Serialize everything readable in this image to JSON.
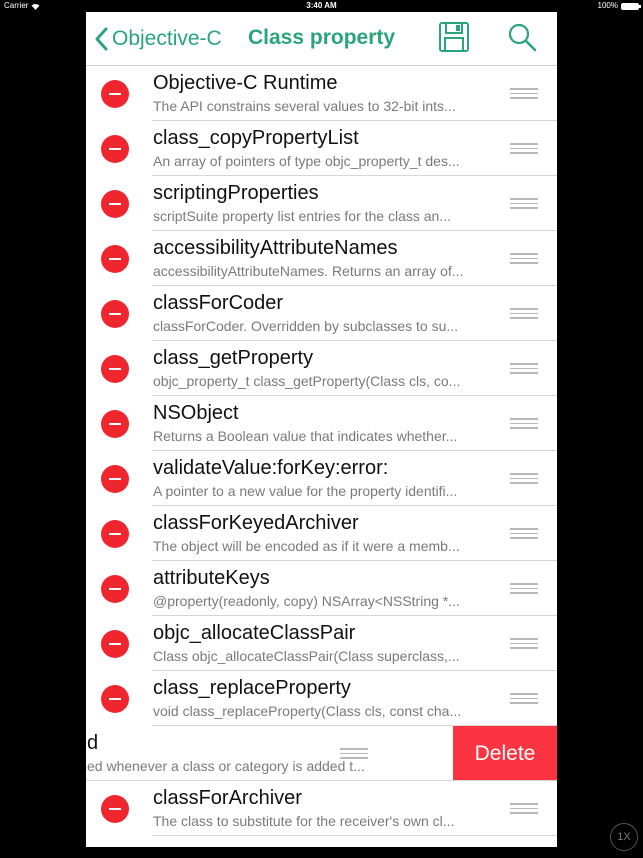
{
  "status_bar": {
    "carrier": "Carrier",
    "time": "3:40 AM",
    "battery": "100%"
  },
  "nav": {
    "back_label": "Objective-C",
    "title": "Class property",
    "accent_color": "#2aa57a"
  },
  "rows": [
    {
      "title": "Objective-C Runtime",
      "subtitle": "The API constrains several values to 32-bit ints..."
    },
    {
      "title": "class_copyPropertyList",
      "subtitle": "An array of pointers of type objc_property_t des..."
    },
    {
      "title": "scriptingProperties",
      "subtitle": "scriptSuite property list entries for the class an..."
    },
    {
      "title": "accessibilityAttributeNames",
      "subtitle": "accessibilityAttributeNames. Returns an array of..."
    },
    {
      "title": "classForCoder",
      "subtitle": "classForCoder. Overridden by subclasses to su..."
    },
    {
      "title": "class_getProperty",
      "subtitle": "objc_property_t class_getProperty(Class cls, co..."
    },
    {
      "title": "NSObject",
      "subtitle": "Returns a Boolean value that indicates whether..."
    },
    {
      "title": "validateValue:forKey:error:",
      "subtitle": "A pointer to a new value for the property identifi..."
    },
    {
      "title": "classForKeyedArchiver",
      "subtitle": "The object will be encoded as if it were a memb..."
    },
    {
      "title": "attributeKeys",
      "subtitle": "@property(readonly, copy) NSArray<NSString *..."
    },
    {
      "title": "objc_allocateClassPair",
      "subtitle": "Class objc_allocateClassPair(Class superclass,..."
    },
    {
      "title": "class_replaceProperty",
      "subtitle": "void class_replaceProperty(Class cls, const cha..."
    }
  ],
  "swiped_row": {
    "title": "d",
    "subtitle": "ed whenever a class or category is added t...",
    "delete_label": "Delete"
  },
  "last_row": {
    "title": "classForArchiver",
    "subtitle": "The class to substitute for the receiver's own cl..."
  },
  "zoom_badge": "1X"
}
